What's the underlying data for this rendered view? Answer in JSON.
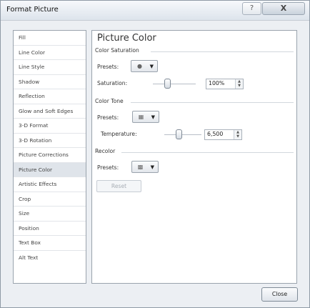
{
  "window": {
    "title": "Format Picture",
    "help_glyph": "?",
    "close_glyph": "X"
  },
  "nav": {
    "items": [
      {
        "label": "Fill"
      },
      {
        "label": "Line Color"
      },
      {
        "label": "Line Style"
      },
      {
        "label": "Shadow"
      },
      {
        "label": "Reflection"
      },
      {
        "label": "Glow and Soft Edges"
      },
      {
        "label": "3-D Format"
      },
      {
        "label": "3-D Rotation"
      },
      {
        "label": "Picture Corrections"
      },
      {
        "label": "Picture Color",
        "selected": true
      },
      {
        "label": "Artistic Effects"
      },
      {
        "label": "Crop"
      },
      {
        "label": "Size"
      },
      {
        "label": "Position"
      },
      {
        "label": "Text Box"
      },
      {
        "label": "Alt Text"
      }
    ]
  },
  "panel": {
    "title": "Picture Color",
    "saturation": {
      "section": "Color Saturation",
      "presets_label": "Presets:",
      "slider_label": "Saturation:",
      "value": "100%",
      "preset_icon": "saturation-preset-icon"
    },
    "tone": {
      "section": "Color Tone",
      "presets_label": "Presets:",
      "slider_label": "Temperature:",
      "value": "6,500",
      "preset_icon": "color-tone-preset-icon"
    },
    "recolor": {
      "section": "Recolor",
      "presets_label": "Presets:",
      "preset_icon": "recolor-preset-icon"
    },
    "reset_label": "Reset"
  },
  "footer": {
    "close_label": "Close"
  }
}
